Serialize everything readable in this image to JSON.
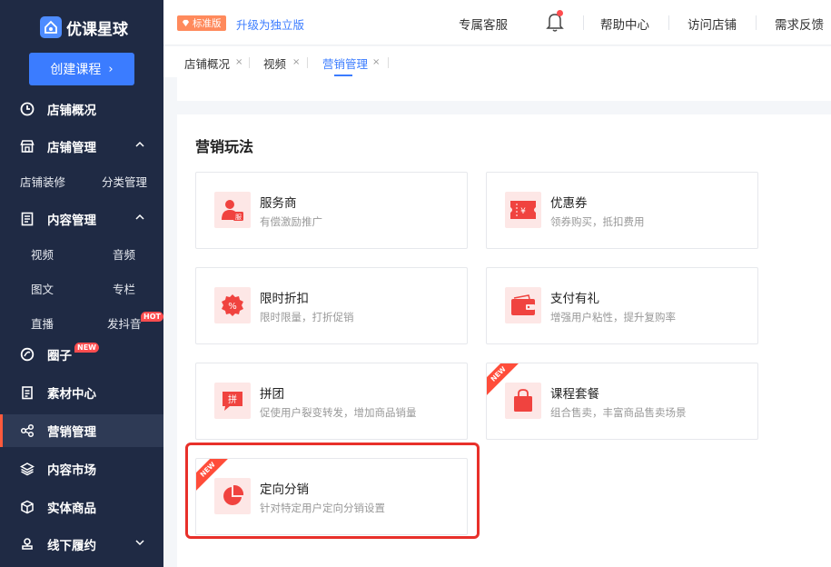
{
  "brand": {
    "name": "优课星球"
  },
  "sidebar": {
    "create_button": "创建课程",
    "items": [
      {
        "label": "店铺概况"
      },
      {
        "label": "店铺管理"
      },
      {
        "label": "内容管理"
      },
      {
        "label": "圈子",
        "badge": "NEW"
      },
      {
        "label": "素材中心"
      },
      {
        "label": "营销管理"
      },
      {
        "label": "内容市场"
      },
      {
        "label": "实体商品"
      },
      {
        "label": "线下履约"
      }
    ],
    "shop_sub": [
      "店铺装修",
      "分类管理"
    ],
    "content_sub": [
      "视频",
      "音频",
      "图文",
      "专栏",
      "直播",
      "发抖音"
    ],
    "hot_badge": "HOT"
  },
  "topbar": {
    "edition": "标准版",
    "upgrade": "升级为独立版",
    "links": [
      "专属客服",
      "帮助中心",
      "访问店铺",
      "需求反馈"
    ]
  },
  "tabs": [
    "店铺概况",
    "视频",
    "营销管理"
  ],
  "tab_close": "×",
  "panel": {
    "title": "营销玩法",
    "ribbon": "NEW",
    "cards": [
      {
        "title": "服务商",
        "desc": "有偿激励推广"
      },
      {
        "title": "优惠券",
        "desc": "领券购买，抵扣费用"
      },
      {
        "title": "限时折扣",
        "desc": "限时限量，打折促销"
      },
      {
        "title": "支付有礼",
        "desc": "增强用户粘性，提升复购率"
      },
      {
        "title": "拼团",
        "desc": "促使用户裂变转发，增加商品销量"
      },
      {
        "title": "课程套餐",
        "desc": "组合售卖，丰富商品售卖场景"
      },
      {
        "title": "定向分销",
        "desc": "针对特定用户定向分销设置"
      }
    ]
  },
  "colors": {
    "accent": "#3b7cff",
    "sidebar": "#1f2a44",
    "red": "#f0433f"
  }
}
